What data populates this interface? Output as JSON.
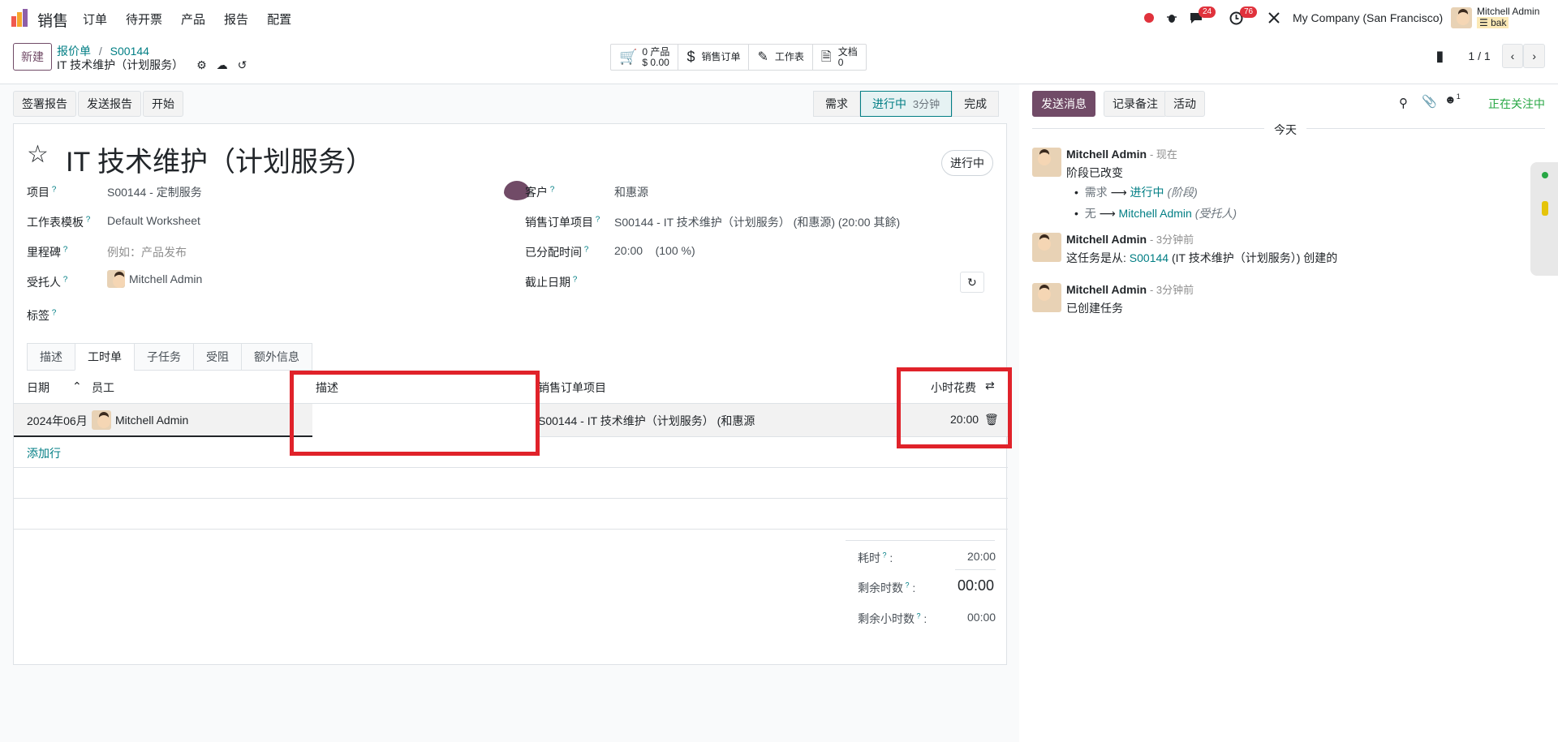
{
  "nav": {
    "app_name": "销售",
    "menu": [
      "订单",
      "待开票",
      "产品",
      "报告",
      "配置"
    ],
    "chat_badge": "24",
    "activity_badge": "76",
    "company": "My Company (San Francisco)",
    "user_name": "Mitchell Admin",
    "user_db": "bak"
  },
  "control": {
    "new_label": "新建",
    "breadcrumb_parent": "报价单",
    "breadcrumb_sep": "/",
    "breadcrumb_order": "S00144",
    "record_title": "IT 技术维护（计划服务）",
    "smart_buttons": [
      {
        "line1": "0 产品",
        "line2": "$ 0.00",
        "icon": "cart-icon"
      },
      {
        "line1": "销售订单",
        "line2": "",
        "icon": "dollar-icon"
      },
      {
        "line1": "工作表",
        "line2": "",
        "icon": "pencil-icon"
      },
      {
        "line1": "文档",
        "line2": "0",
        "icon": "document-icon"
      }
    ],
    "pager": "1 / 1"
  },
  "statusbar": {
    "buttons": [
      "签署报告",
      "发送报告",
      "开始"
    ],
    "stages": [
      "需求",
      "进行中",
      "完成"
    ],
    "active_stage_time": "3分钟"
  },
  "form": {
    "title": "IT 技术维护（计划服务）",
    "status_pill": "进行中",
    "fields_left": [
      {
        "label": "项目",
        "value": "S00144 - 定制服务"
      },
      {
        "label": "工作表模板",
        "value": "Default Worksheet"
      },
      {
        "label": "里程碑",
        "value": "例如：产品发布"
      },
      {
        "label": "受托人",
        "value": "Mitchell Admin"
      },
      {
        "label": "标签",
        "value": ""
      }
    ],
    "fields_right": [
      {
        "label": "客户",
        "value": "和惠源"
      },
      {
        "label": "销售订单项目",
        "value": "S00144 - IT 技术维护（计划服务） (和惠源) (20:00 其餘)"
      },
      {
        "label": "已分配时间",
        "value": "20:00    (100 %)"
      },
      {
        "label": "截止日期",
        "value": ""
      }
    ],
    "tabs": [
      "描述",
      "工时单",
      "子任务",
      "受阻",
      "额外信息"
    ],
    "active_tab": "工时单"
  },
  "timesheet": {
    "columns": [
      "日期",
      "员工",
      "描述",
      "销售订单项目",
      "小时花费"
    ],
    "rows": [
      {
        "date": "2024年06月",
        "employee": "Mitchell Admin",
        "description": "",
        "so_line": "S00144 - IT 技术维护（计划服务） (和惠源",
        "hours": "20:00"
      }
    ],
    "add_line": "添加行",
    "totals": [
      {
        "label": "耗时",
        "value": "20:00"
      },
      {
        "label": "剩余时数",
        "value": "00:00"
      },
      {
        "label": "剩余小时数",
        "value": "00:00"
      }
    ]
  },
  "chatter": {
    "send_message": "发送消息",
    "log_note": "记录备注",
    "activity": "活动",
    "attachment_count": "1",
    "following": "正在关注中",
    "today": "今天",
    "messages": [
      {
        "author": "Mitchell Admin",
        "time": "- 现在",
        "body": "阶段已改变"
      },
      {
        "author": "Mitchell Admin",
        "time": "- 3分钟前",
        "body": "这任务是从:"
      },
      {
        "author": "Mitchell Admin",
        "time": "- 3分钟前",
        "body": "已创建任务"
      }
    ],
    "changes": [
      {
        "from": "需求",
        "to": "进行中",
        "field": "(阶段)"
      },
      {
        "from": "无",
        "to": "Mitchell Admin",
        "field": "(受托人)"
      }
    ],
    "origin_link": "S00144",
    "origin_tail": "(IT 技术维护（计划服务）) 创建的"
  },
  "colors": {
    "brand": "#714b67",
    "teal": "#017e84",
    "red_box": "#e0222a"
  }
}
